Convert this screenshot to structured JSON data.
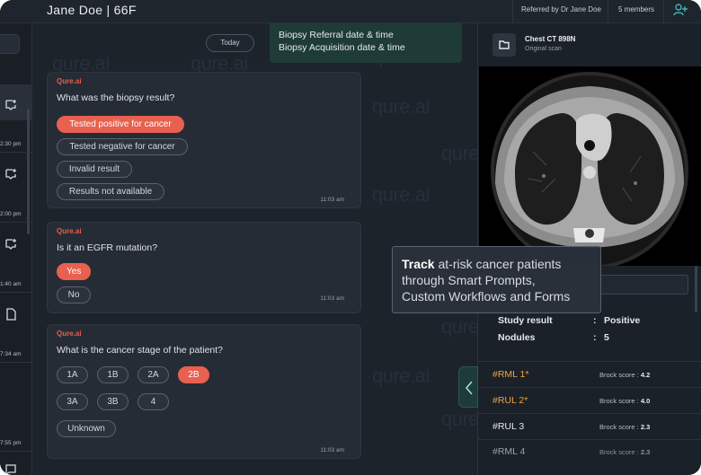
{
  "header": {
    "title": "Jane Doe | 66F",
    "referred_by": "Referred by Dr Jane Doe",
    "members": "5 members"
  },
  "rail": {
    "times": [
      "2:30 pm",
      "2:00 pm",
      "1:40 am",
      "7:34 am",
      "7:55 pm"
    ]
  },
  "chat": {
    "watermark": "qure.ai",
    "today": "Today",
    "biopsy_lines": [
      "Biopsy Referral date & time",
      "Biopsy Acquisition date & time"
    ],
    "cards": [
      {
        "from": "Qure.ai",
        "question": "What was the biopsy result?",
        "options": [
          "Tested positive for cancer",
          "Tested negative for cancer",
          "Invalid result",
          "Results not available"
        ],
        "selected": 0,
        "time": "11:03 am"
      },
      {
        "from": "Qure.ai",
        "question": "Is it an EGFR mutation?",
        "options": [
          "Yes",
          "No"
        ],
        "selected": 0,
        "time": "11:03 am"
      },
      {
        "from": "Qure.ai",
        "question": "What is the cancer stage of the patient?",
        "options": [
          "1A",
          "1B",
          "2A",
          "2B",
          "3A",
          "3B",
          "4",
          "Unknown"
        ],
        "selected": 3,
        "time": "11:03 am"
      }
    ]
  },
  "scan": {
    "title": "Chest CT 898N",
    "subtitle": "Original scan"
  },
  "results": {
    "study_label": "Study result",
    "study_value": "Positive",
    "nodules_label": "Nodules",
    "nodules_value": "5",
    "colon": ":"
  },
  "nodules": [
    {
      "name": "#RML 1*",
      "score_label": "Brock score :",
      "score": "4.2",
      "color": "#f0a43a"
    },
    {
      "name": "#RUL 2*",
      "score_label": "Brock score :",
      "score": "4.0",
      "color": "#f0a43a"
    },
    {
      "name": "#RUL 3",
      "score_label": "Brock score :",
      "score": "2.3",
      "color": "#e6e9ee"
    },
    {
      "name": "#RML 4",
      "score_label": "Brock score :",
      "score": "2.3",
      "color": "#9aa1ab"
    }
  ],
  "overlay": {
    "strong": "Track",
    "line1_rest": " at-risk cancer patients",
    "line2": "through Smart Prompts,",
    "line3": "Custom Workflows and Forms"
  },
  "colors": {
    "accent": "#e8604f",
    "teal": "#1f3b38",
    "amber": "#f0a43a"
  }
}
